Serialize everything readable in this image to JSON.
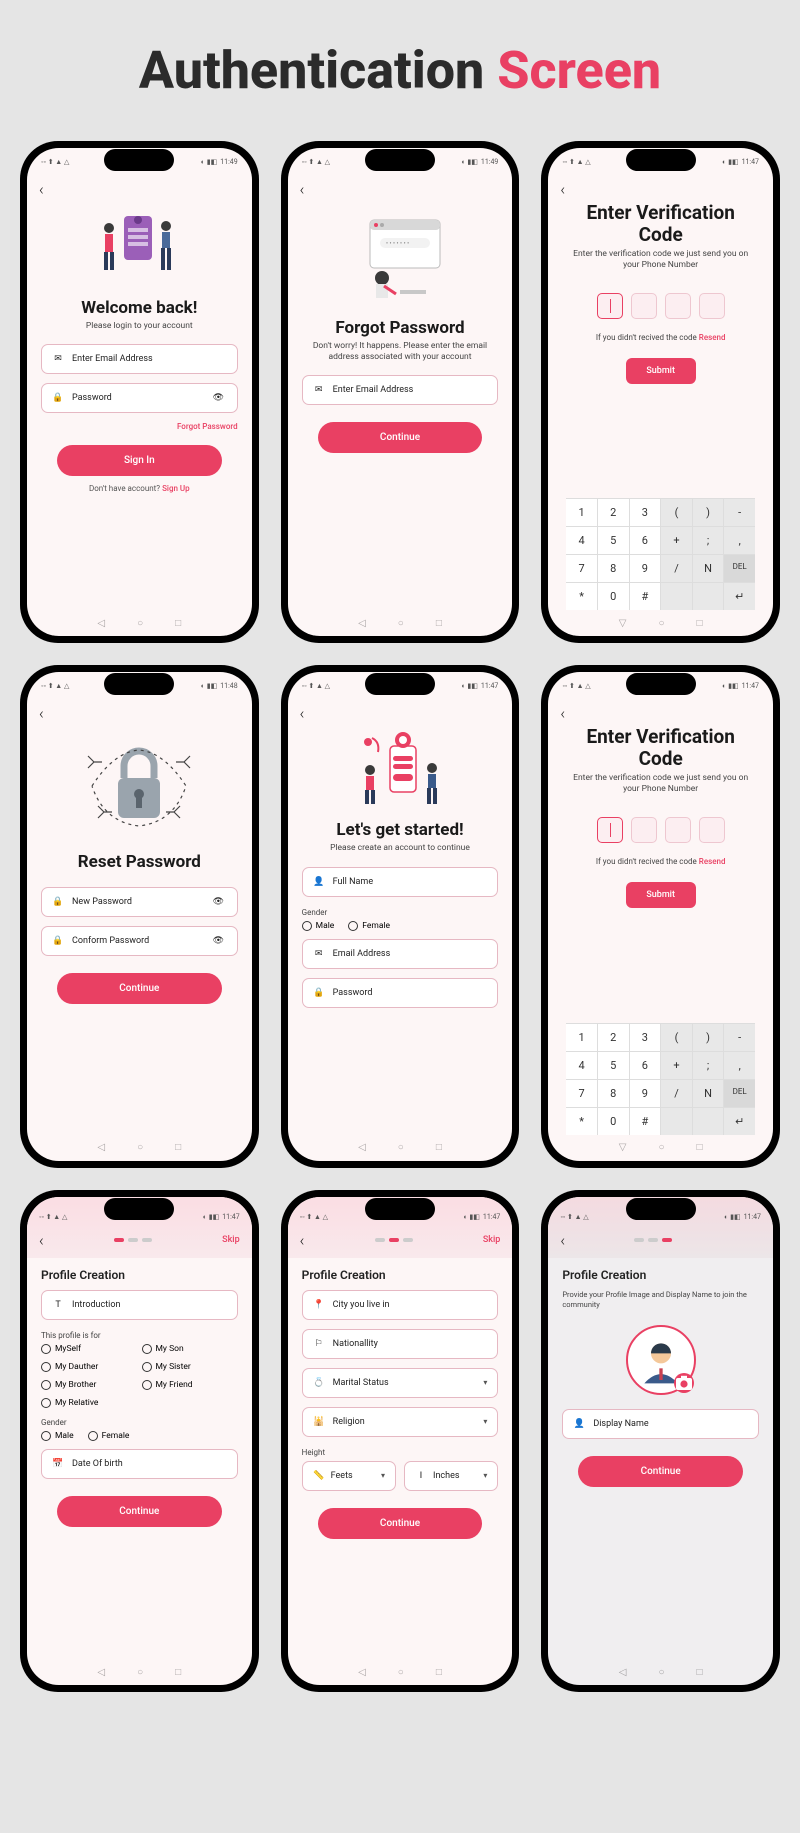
{
  "title": {
    "t1": "Authentication ",
    "t2": "Screen"
  },
  "status": {
    "left": "◦◦ ⬆ ▲ △",
    "time": "11:49",
    "time2": "11:47",
    "time3": "11:48",
    "batt": "●●47"
  },
  "s1": {
    "h": "Welcome back!",
    "sub": "Please login to your account",
    "email": "Enter Email Address",
    "pass": "Password",
    "forgot": "Forgot Password",
    "btn": "Sign In",
    "f1": "Don't have account?  ",
    "f2": "Sign Up"
  },
  "s2": {
    "h": "Forgot Password",
    "sub": "Don't worry! It happens. Please enter the email address associated with your account",
    "email": "Enter Email Address",
    "btn": "Continue"
  },
  "s3": {
    "h": "Enter Verification Code",
    "sub": "Enter the verification code we just send you on your Phone Number",
    "r1": "If you didn't recived the code   ",
    "r2": "Resend",
    "btn": "Submit"
  },
  "s4": {
    "h": "Reset Password",
    "np": "New Password",
    "cp": "Conform Password",
    "btn": "Continue"
  },
  "s5": {
    "h": "Let's get started!",
    "sub": "Please create an account to continue",
    "fn": "Full Name",
    "g": "Gender",
    "m": "Male",
    "f": "Female",
    "em": "Email Address",
    "pw": "Password"
  },
  "s7": {
    "skip": "Skip",
    "h": "Profile Creation",
    "intro": "Introduction",
    "pf": "This profile is for",
    "o": [
      "MySelf",
      "My Son",
      "My Dauther",
      "My Sister",
      "My Brother",
      "My Friend",
      "My Relative"
    ],
    "g": "Gender",
    "m": "Male",
    "f": "Female",
    "dob": "Date Of birth",
    "btn": "Continue"
  },
  "s8": {
    "skip": "Skip",
    "h": "Profile Creation",
    "city": "City you live in",
    "nat": "Nationallity",
    "ms": "Marital Status",
    "rel": "Religion",
    "ht": "Height",
    "ft": "Feets",
    "in": "Inches",
    "btn": "Continue"
  },
  "s9": {
    "h": "Profile Creation",
    "sub": "Provide your Profile Image and Display Name to join the community",
    "dn": "Display Name",
    "btn": "Continue"
  },
  "keypad": [
    [
      "1",
      "2",
      "3",
      "(",
      ")",
      "-"
    ],
    [
      "4",
      "5",
      "6",
      "+",
      ";",
      ","
    ],
    [
      "7",
      "8",
      "9",
      "/",
      "N",
      "DEL"
    ],
    [
      "*",
      "0",
      "#",
      " ",
      " ",
      "↵"
    ]
  ]
}
